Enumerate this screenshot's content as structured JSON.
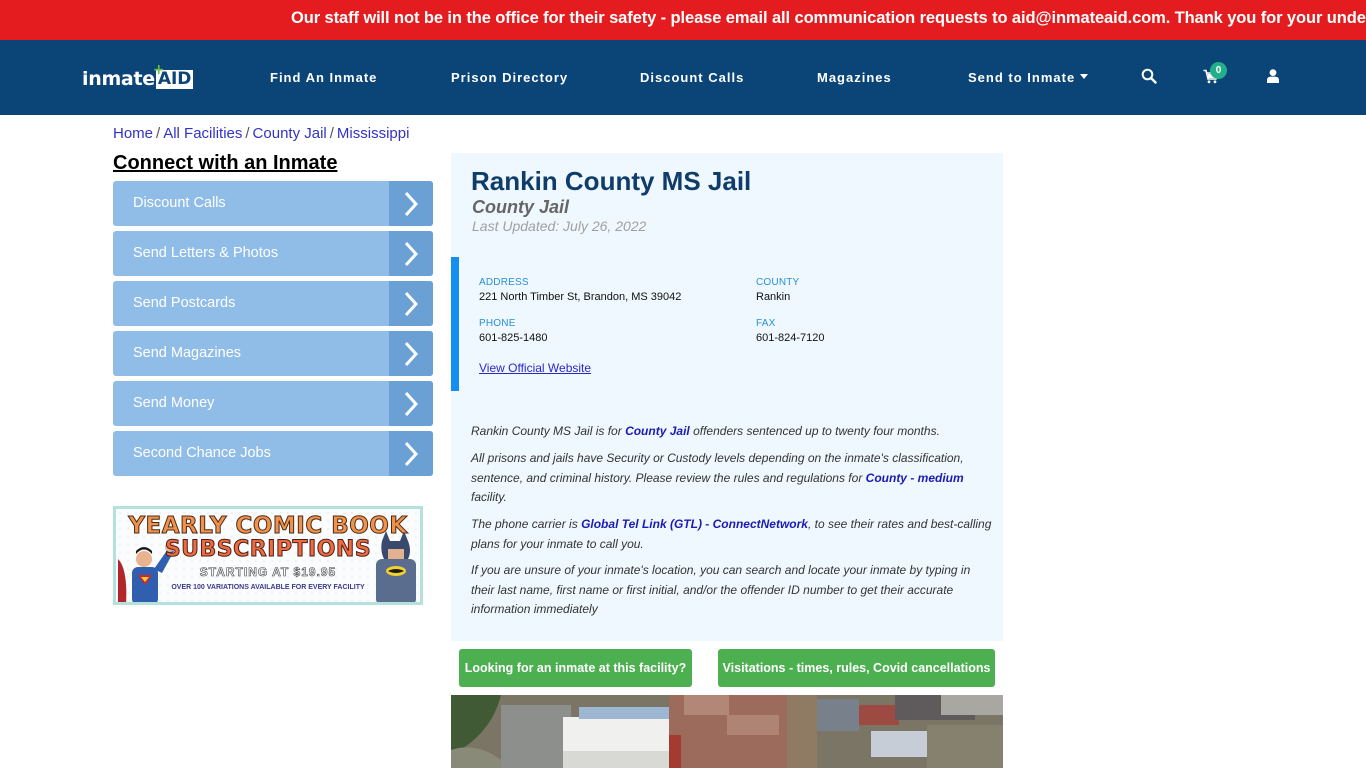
{
  "alert": {
    "text": "Our staff will not be in the office for their safety - please email all communication requests to aid@inmateaid.com. Thank you for your understanding."
  },
  "brand": {
    "logo_part1": "inmate",
    "logo_part2": "AID",
    "logo_plus": "+"
  },
  "nav": {
    "items": [
      {
        "label": "Find An Inmate"
      },
      {
        "label": "Prison Directory"
      },
      {
        "label": "Discount Calls"
      },
      {
        "label": "Magazines"
      },
      {
        "label": "Send to Inmate"
      }
    ],
    "icons": {
      "search": "search-icon",
      "cart": "cart-icon",
      "user": "user-icon"
    },
    "cart_count": "0"
  },
  "breadcrumb": {
    "items": [
      {
        "label": "Home"
      },
      {
        "label": "All Facilities"
      },
      {
        "label": "County Jail"
      },
      {
        "label": "Mississippi"
      }
    ],
    "separator": "/"
  },
  "sidebar": {
    "title": "Connect with an Inmate",
    "buttons": [
      {
        "label": "Discount Calls"
      },
      {
        "label": "Send Letters & Photos"
      },
      {
        "label": "Send Postcards"
      },
      {
        "label": "Send Magazines"
      },
      {
        "label": "Send Money"
      },
      {
        "label": "Second Chance Jobs"
      }
    ],
    "promo": {
      "line1": "YEARLY COMIC BOOK",
      "line2": "SUBSCRIPTIONS",
      "line3": "STARTING AT $19.95",
      "line4": "OVER 100 VARIATIONS AVAILABLE FOR EVERY FACILITY"
    }
  },
  "facility": {
    "name": "Rankin County MS Jail",
    "type": "County Jail",
    "last_updated": "Last Updated: July 26, 2022",
    "address_label": "ADDRESS",
    "address": "221 North Timber St, Brandon, MS 39042",
    "county_label": "COUNTY",
    "county": "Rankin",
    "phone_label": "PHONE",
    "phone": "601-825-1480",
    "fax_label": "FAX",
    "fax": "601-824-7120",
    "website_link": "View Official Website"
  },
  "description": {
    "p1_a": "Rankin County MS Jail is for ",
    "p1_link": "County Jail",
    "p1_b": " offenders sentenced up to twenty four months.",
    "p2_a": "All prisons and jails have Security or Custody levels depending on the inmate's classification, sentence, and criminal history. Please review the rules and regulations for ",
    "p2_link": "County - medium",
    "p2_b": " facility.",
    "p3_a": "The phone carrier is ",
    "p3_link": "Global Tel Link (GTL) - ConnectNetwork",
    "p3_b": ", to see their rates and best-calling plans for your inmate to call you.",
    "p4": "If you are unsure of your inmate's location, you can search and locate your inmate by typing in their last name, first name or first initial, and/or the offender ID number to get their accurate information immediately"
  },
  "actions": {
    "find_inmate": "Looking for an inmate at this facility?",
    "visitations": "Visitations - times, rules, Covid cancellations"
  },
  "colors": {
    "alert_red": "#e51c1f",
    "nav_blue": "#0b4477",
    "sidebar_button": "#90bde8",
    "sidebar_arrow": "#6aa0d4",
    "card_bg": "#eef8fe",
    "accent_blue": "#148ef0",
    "action_green": "#4caf50",
    "badge_teal": "#21b08a"
  }
}
